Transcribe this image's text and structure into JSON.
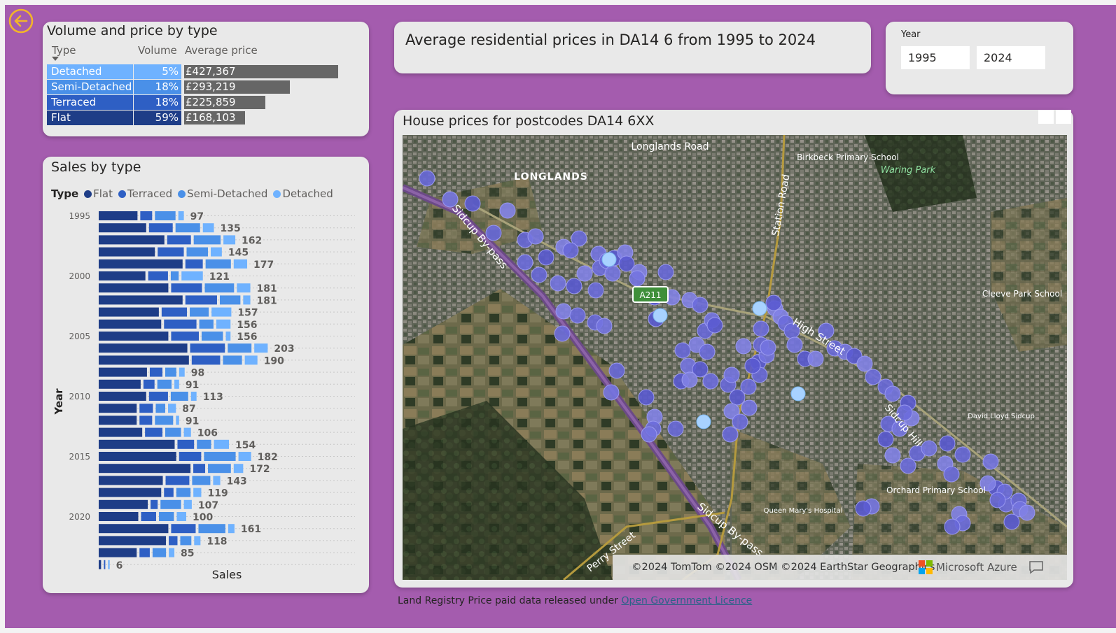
{
  "back_icon": "back-arrow-icon",
  "volume_table": {
    "title": "Volume and price by type",
    "headers": {
      "type": "Type",
      "volume": "Volume",
      "avg_price": "Average price"
    },
    "rows": [
      {
        "type": "Detached",
        "volume": "5%",
        "price": "£427,367",
        "price_value": 427367,
        "color": "#6fb2ff"
      },
      {
        "type": "Semi-Detached",
        "volume": "18%",
        "price": "£293,219",
        "price_value": 293219,
        "color": "#4a90e8"
      },
      {
        "type": "Terraced",
        "volume": "18%",
        "price": "£225,859",
        "price_value": 225859,
        "color": "#2e5fc4"
      },
      {
        "type": "Flat",
        "volume": "59%",
        "price": "£168,103",
        "price_value": 168103,
        "color": "#1e3d87"
      }
    ]
  },
  "title_card": {
    "text": "Average residential prices in DA14 6 from 1995 to 2024"
  },
  "year_filter": {
    "label": "Year",
    "from": "1995",
    "to": "2024"
  },
  "sales_chart": {
    "title": "Sales by type",
    "legend_label": "Type",
    "legend": [
      {
        "name": "Flat",
        "color": "#1e3d87"
      },
      {
        "name": "Terraced",
        "color": "#2e5fc4"
      },
      {
        "name": "Semi-Detached",
        "color": "#4a90e8"
      },
      {
        "name": "Detached",
        "color": "#6fb2ff"
      }
    ],
    "y_label": "Year",
    "x_label": "Sales"
  },
  "chart_data": {
    "type": "bar",
    "orientation": "horizontal",
    "stacked": true,
    "title": "Sales by type",
    "xlabel": "Sales",
    "ylabel": "Year",
    "y_tick_labels": [
      "1995",
      "2000",
      "2005",
      "2010",
      "2015",
      "2020"
    ],
    "categories": [
      "1995",
      "1996",
      "1997",
      "1998",
      "1999",
      "2000",
      "2001",
      "2002",
      "2003",
      "2004",
      "2005",
      "2006",
      "2007",
      "2008",
      "2009",
      "2010",
      "2011",
      "2012",
      "2013",
      "2014",
      "2015",
      "2016",
      "2017",
      "2018",
      "2019",
      "2020",
      "2021",
      "2022",
      "2023",
      "2024"
    ],
    "totals": [
      97,
      135,
      162,
      145,
      177,
      121,
      181,
      181,
      157,
      156,
      156,
      203,
      190,
      98,
      91,
      113,
      87,
      91,
      106,
      154,
      182,
      172,
      143,
      119,
      107,
      100,
      161,
      118,
      85,
      6
    ],
    "series": [
      {
        "name": "Flat",
        "values": [
          49,
          60,
          83,
          71,
          106,
          59,
          88,
          106,
          76,
          79,
          88,
          112,
          114,
          61,
          53,
          60,
          48,
          48,
          55,
          96,
          98,
          116,
          81,
          79,
          62,
          50,
          88,
          85,
          48,
          3
        ]
      },
      {
        "name": "Terraced",
        "values": [
          15,
          30,
          30,
          33,
          22,
          25,
          39,
          40,
          32,
          41,
          35,
          44,
          36,
          16,
          14,
          24,
          17,
          16,
          22,
          21,
          28,
          15,
          30,
          12,
          9,
          19,
          31,
          11,
          13,
          1
        ]
      },
      {
        "name": "Semi-Detached",
        "values": [
          26,
          31,
          34,
          27,
          32,
          10,
          37,
          26,
          24,
          18,
          27,
          30,
          24,
          14,
          18,
          22,
          12,
          23,
          20,
          18,
          40,
          29,
          23,
          18,
          26,
          19,
          34,
          14,
          17,
          0
        ]
      },
      {
        "name": "Detached",
        "values": [
          7,
          14,
          15,
          14,
          17,
          27,
          17,
          9,
          25,
          18,
          6,
          17,
          16,
          7,
          6,
          7,
          10,
          4,
          9,
          19,
          16,
          12,
          9,
          10,
          10,
          12,
          8,
          8,
          7,
          2
        ]
      }
    ]
  },
  "map": {
    "title": "House prices for postcodes DA14 6XX",
    "labels": {
      "longlands_road": "Longlands Road",
      "longlands": "LONGLANDS",
      "birkbeck": "Birkbeck Primary School",
      "waring_park": "Waring Park",
      "station_road": "Station Road",
      "sidcup_bypass": "Sidcup By-pass",
      "a211": "A211",
      "high_street": "High Street",
      "cleeve": "Cleeve Park School",
      "sidcup_hill": "Sidcup Hill",
      "david_lloyd": "David Lloyd Sidcup",
      "orchard": "Orchard Primary School",
      "queen_marys": "Queen Mary's Hospital",
      "perry_street": "Perry Street",
      "sidcup_bypass_2": "Sidcup By-pass"
    },
    "attribution": "©2024 TomTom  ©2024 OSM  ©2024 EarthStar Geographics",
    "provider": "Microsoft Azure",
    "provider_icon": "microsoft-logo-icon",
    "feedback_icon": "feedback-icon"
  },
  "footer": {
    "text": "Land Registry Price paid data released under ",
    "link": "Open Government Licence "
  }
}
